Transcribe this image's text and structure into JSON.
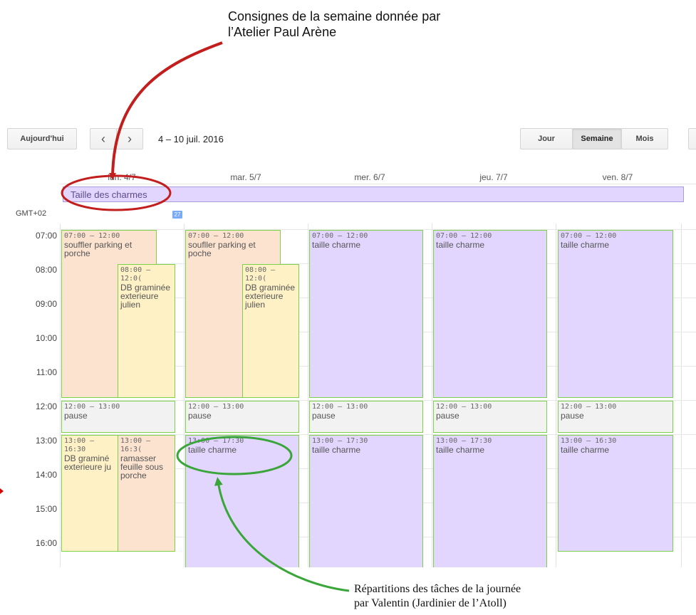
{
  "annotations": {
    "top_note": "Consignes de la semaine donnée par l’Atelier Paul Arène",
    "bottom_note_line1": "Répartitions des tâches de la journée",
    "bottom_note_line2": "par Valentin (Jardinier de l’Atoll)",
    "colors": {
      "red": "#c31e1e",
      "green": "#3aa63a"
    }
  },
  "toolbar": {
    "today_label": "Aujourd'hui",
    "prev_icon": "chevron-left-icon",
    "next_icon": "chevron-right-icon",
    "prev_glyph": "‹",
    "next_glyph": "›",
    "date_range": "4 – 10 juil. 2016",
    "views": {
      "day": "Jour",
      "week": "Semaine",
      "month": "Mois"
    },
    "active_view": "Semaine"
  },
  "calendar": {
    "timezone": "GMT+02",
    "week_badge": "27",
    "days": [
      "lun. 4/7",
      "mar. 5/7",
      "mer. 6/7",
      "jeu. 7/7",
      "ven. 8/7"
    ],
    "all_day_event": "Taille des charmes",
    "hours": [
      "07:00",
      "08:00",
      "09:00",
      "10:00",
      "11:00",
      "12:00",
      "13:00",
      "14:00",
      "15:00",
      "16:00"
    ],
    "events": {
      "mon_1": {
        "time": "07:00 – 12:00",
        "title": "souffler parking et porche"
      },
      "mon_2": {
        "time": "08:00 – 12:0(",
        "title": "DB graminée exterieure julien"
      },
      "mon_3": {
        "time": "12:00 – 13:00",
        "title": "pause"
      },
      "mon_4": {
        "time": "13:00 – 16:30",
        "title": "DB graminé exterieure ju"
      },
      "mon_5": {
        "time": "13:00 – 16:3(",
        "title": "ramasser feuille sous porche"
      },
      "tue_1": {
        "time": "07:00 – 12:00",
        "title": "soufller parking et poche"
      },
      "tue_2": {
        "time": "08:00 – 12:0(",
        "title": "DB graminée exterieure julien"
      },
      "tue_3": {
        "time": "12:00 – 13:00",
        "title": "pause"
      },
      "tue_4": {
        "time": "13:00 – 17:30",
        "title": "taille charme"
      },
      "wed_1": {
        "time": "07:00 – 12:00",
        "title": "taille charme"
      },
      "wed_2": {
        "time": "12:00 – 13:00",
        "title": "pause"
      },
      "wed_3": {
        "time": "13:00 – 17:30",
        "title": "taille charme"
      },
      "thu_1": {
        "time": "07:00 – 12:00",
        "title": "taille charme"
      },
      "thu_2": {
        "time": "12:00 – 13:00",
        "title": "pause"
      },
      "thu_3": {
        "time": "13:00 – 17:30",
        "title": "taille charme"
      },
      "fri_1": {
        "time": "07:00 – 12:00",
        "title": "taille charme"
      },
      "fri_2": {
        "time": "12:00 – 13:00",
        "title": "pause"
      },
      "fri_3": {
        "time": "13:00 – 16:30",
        "title": "taille charme"
      }
    }
  },
  "colors": {
    "event_border": "#7bd148",
    "orange_event": "#fce3cf",
    "yellow_event": "#fef1c6",
    "gray_event": "#f2f2f2",
    "purple_event": "#e2d6ff"
  }
}
